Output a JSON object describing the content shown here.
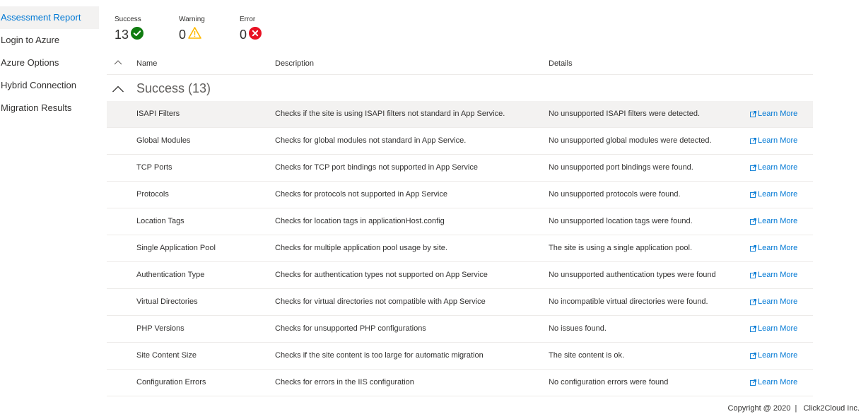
{
  "sidebar": {
    "items": [
      {
        "label": "Assessment Report"
      },
      {
        "label": "Login to Azure"
      },
      {
        "label": "Azure Options"
      },
      {
        "label": "Hybrid Connection"
      },
      {
        "label": "Migration Results"
      }
    ]
  },
  "summary": {
    "success": {
      "label": "Success",
      "value": "13"
    },
    "warning": {
      "label": "Warning",
      "value": "0"
    },
    "error": {
      "label": "Error",
      "value": "0"
    }
  },
  "table": {
    "columns": {
      "name": "Name",
      "description": "Description",
      "details": "Details"
    },
    "group_title": "Success (13)",
    "rows": [
      {
        "name": "ISAPI Filters",
        "description": "Checks if the site is using ISAPI filters not standard in App Service.",
        "details": "No unsupported ISAPI filters were detected.",
        "link": "Learn More"
      },
      {
        "name": "Global Modules",
        "description": "Checks for global modules not standard in App Service.",
        "details": "No unsupported global modules were detected.",
        "link": "Learn More"
      },
      {
        "name": "TCP Ports",
        "description": "Checks for TCP port bindings not supported in App Service",
        "details": "No unsupported port bindings were found.",
        "link": "Learn More"
      },
      {
        "name": "Protocols",
        "description": "Checks for protocols not supported in App Service",
        "details": "No unsupported protocols were found.",
        "link": "Learn More"
      },
      {
        "name": "Location Tags",
        "description": "Checks for location tags in applicationHost.config",
        "details": "No unsupported location tags were found.",
        "link": "Learn More"
      },
      {
        "name": "Single Application Pool",
        "description": "Checks for multiple application pool usage by site.",
        "details": "The site is using a single application pool.",
        "link": "Learn More"
      },
      {
        "name": "Authentication Type",
        "description": "Checks for authentication types not supported on App Service",
        "details": "No unsupported authentication types were found",
        "link": "Learn More"
      },
      {
        "name": "Virtual Directories",
        "description": "Checks for virtual directories not compatible with App Service",
        "details": "No incompatible virtual directories were found.",
        "link": "Learn More"
      },
      {
        "name": "PHP Versions",
        "description": "Checks for unsupported PHP configurations",
        "details": "No issues found.",
        "link": "Learn More"
      },
      {
        "name": "Site Content Size",
        "description": "Checks if the site content is too large for automatic migration",
        "details": "The site content is ok.",
        "link": "Learn More"
      },
      {
        "name": "Configuration Errors",
        "description": "Checks for errors in the IIS configuration",
        "details": "No configuration errors were found",
        "link": "Learn More"
      }
    ]
  },
  "footer": {
    "text": "Copyright @ 2020  |   Click2Cloud Inc."
  },
  "colors": {
    "accent": "#0078d4",
    "success": "#107c10",
    "warning": "#ffb900",
    "error": "#e81123"
  }
}
